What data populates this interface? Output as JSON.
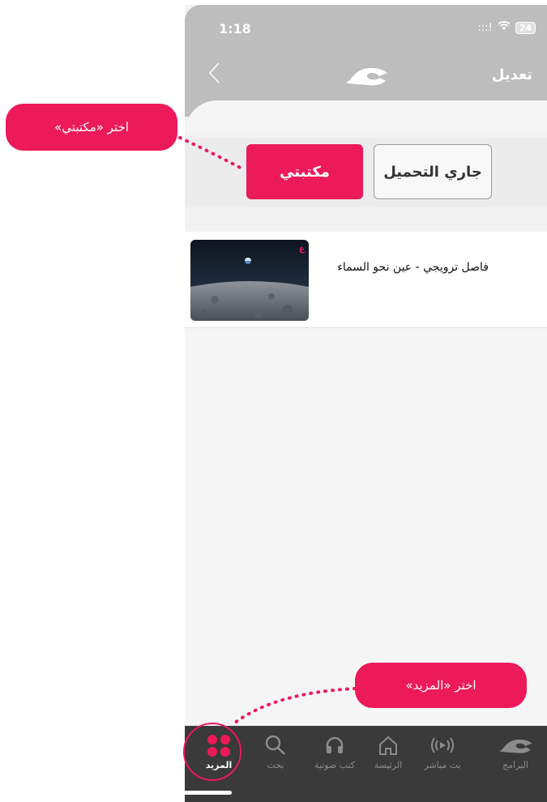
{
  "status_bar": {
    "time": "1:18",
    "signal": ":::!",
    "battery": "24"
  },
  "header": {
    "edit_label": "تعديل"
  },
  "tabs": {
    "my_library": "مكتبتي",
    "downloading": "جاري التحميل"
  },
  "items": [
    {
      "title": "فاصل ترويجي - عين نحو السماء"
    }
  ],
  "tabbar": {
    "programs": "البرامج",
    "live": "بث مباشر",
    "home": "الرئيسة",
    "audiobooks": "كتب صوتية",
    "search": "بحث",
    "more": "المزيد"
  },
  "callouts": {
    "choose_library": "اختر «مكتبتي»",
    "choose_more": "اختر «المزيد»"
  },
  "colors": {
    "accent": "#ec1a5a",
    "header": "#bdbdbd",
    "tabbar": "#3a3a3a"
  }
}
